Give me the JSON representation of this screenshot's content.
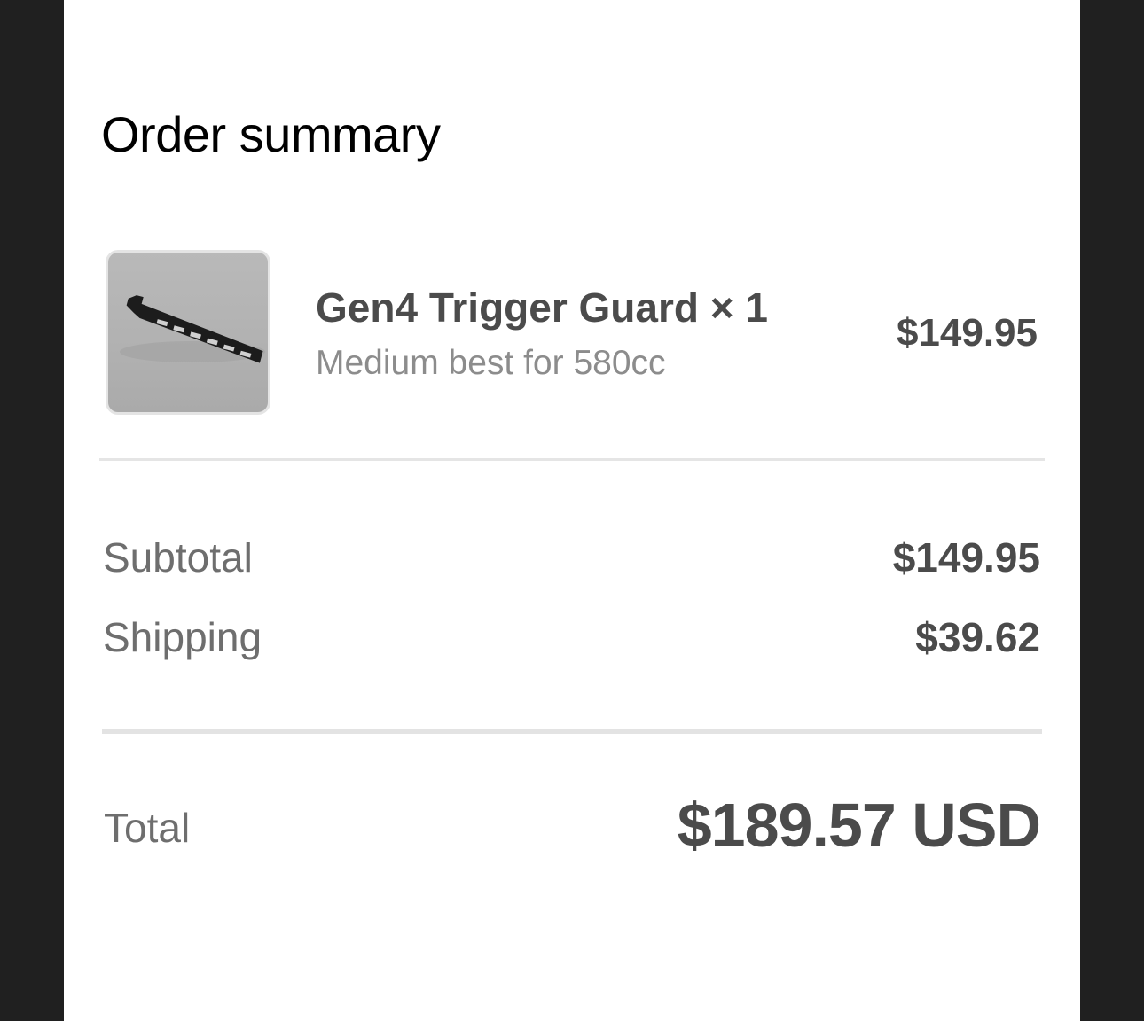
{
  "order_summary": {
    "title": "Order summary",
    "line_item": {
      "image": "product-thumbnail-trigger-guard",
      "name": "Gen4 Trigger Guard × 1",
      "variant": "Medium best for 580cc",
      "price": "$149.95"
    },
    "subtotal": {
      "label": "Subtotal",
      "value": "$149.95"
    },
    "shipping": {
      "label": "Shipping",
      "value": "$39.62"
    },
    "total": {
      "label": "Total",
      "value": "$189.57 USD"
    }
  },
  "colors": {
    "frame": "#202020",
    "panel": "#ffffff",
    "primary_text": "#4b4b4b",
    "secondary_text": "#8c8c8c",
    "divider": "#e5e5e5"
  }
}
